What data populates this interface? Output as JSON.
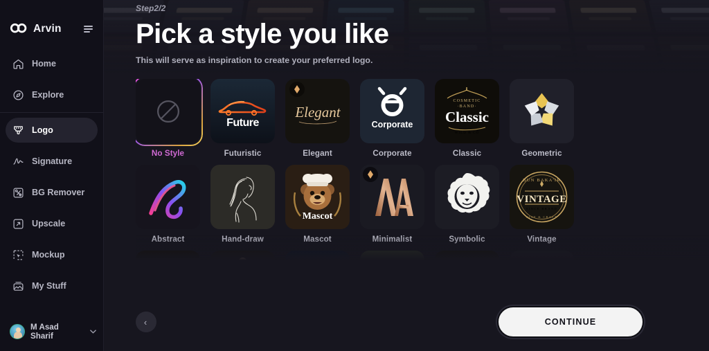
{
  "sidebar": {
    "brand": "Arvin",
    "menu_icon": "hamburger-icon",
    "items": [
      {
        "label": "Home",
        "icon": "home-icon",
        "active": false
      },
      {
        "label": "Explore",
        "icon": "compass-icon",
        "active": false
      },
      {
        "label": "Logo",
        "icon": "brush-icon",
        "active": true
      },
      {
        "label": "Signature",
        "icon": "signature-icon",
        "active": false
      },
      {
        "label": "BG Remover",
        "icon": "scissors-icon",
        "active": false
      },
      {
        "label": "Upscale",
        "icon": "expand-icon",
        "active": false
      },
      {
        "label": "Mockup",
        "icon": "mockup-icon",
        "active": false
      },
      {
        "label": "My Stuff",
        "icon": "gallery-icon",
        "active": false
      }
    ],
    "user": {
      "name": "M Asad Sharif",
      "caret": "⌄",
      "avatar": "user-avatar"
    }
  },
  "main": {
    "step": "Step2/2",
    "title": "Pick a style you like",
    "subtitle": "This will serve as inspiration to create your preferred logo.",
    "styles_row1": [
      {
        "label": "No Style",
        "art": "no-style",
        "selected": true
      },
      {
        "label": "Futuristic",
        "art": "futuristic",
        "selected": false
      },
      {
        "label": "Elegant",
        "art": "elegant",
        "selected": false
      },
      {
        "label": "Corporate",
        "art": "corporate",
        "selected": false
      },
      {
        "label": "Classic",
        "art": "classic",
        "selected": false
      },
      {
        "label": "Geometric",
        "art": "geometric",
        "selected": false
      }
    ],
    "styles_row2": [
      {
        "label": "Abstract",
        "art": "abstract",
        "selected": false
      },
      {
        "label": "Hand-draw",
        "art": "handdraw",
        "selected": false
      },
      {
        "label": "Mascot",
        "art": "mascot",
        "selected": false
      },
      {
        "label": "Minimalist",
        "art": "minimalist",
        "selected": false
      },
      {
        "label": "Symbolic",
        "art": "symbolic",
        "selected": false
      },
      {
        "label": "Vintage",
        "art": "vintage",
        "selected": false
      }
    ],
    "styles_row3": [
      {
        "label": "",
        "art": "r3a",
        "selected": false
      },
      {
        "label": "",
        "art": "r3b",
        "selected": false
      },
      {
        "label": "",
        "art": "r3c",
        "selected": false
      },
      {
        "label": "",
        "art": "r3d",
        "selected": false
      },
      {
        "label": "",
        "art": "r3e",
        "selected": false
      },
      {
        "label": "",
        "art": "r3f",
        "selected": false
      }
    ],
    "back_label": "‹",
    "continue_label": "CONTINUE"
  },
  "colors": {
    "app_bg": "#17161f",
    "sidebar_bg": "#111019",
    "card_bg": "#1d1c26",
    "selected_from": "#e855d8",
    "selected_to": "#f3d25e",
    "selected_label": "#d06ad4",
    "continue_bg": "#f3f3f3",
    "text_primary": "#ffffff",
    "text_muted": "#b0b0bd"
  }
}
